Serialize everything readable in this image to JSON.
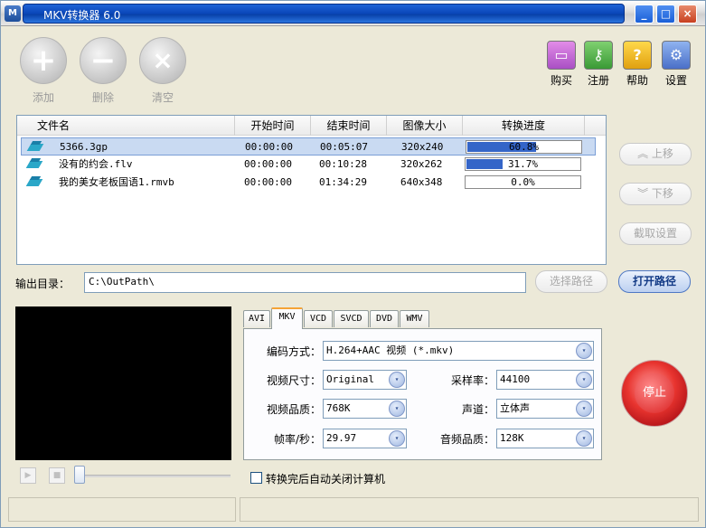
{
  "window": {
    "title": "MKV转换器 6.0"
  },
  "title_buttons": {
    "minimize": "_",
    "maximize": "□",
    "close": "×"
  },
  "toolbar": {
    "add": "添加",
    "delete": "删除",
    "clear": "清空"
  },
  "tools": {
    "buy": "购买",
    "register": "注册",
    "help": "帮助",
    "settings": "设置"
  },
  "columns": [
    "文件名",
    "开始时间",
    "结束时间",
    "图像大小",
    "转换进度"
  ],
  "files": [
    {
      "name": "5366.3gp",
      "start": "00:00:00",
      "end": "00:05:07",
      "size": "320x240",
      "progress_text": "60.8%",
      "progress": 0.608,
      "selected": true
    },
    {
      "name": "没有的约会.flv",
      "start": "00:00:00",
      "end": "00:10:28",
      "size": "320x262",
      "progress_text": "31.7%",
      "progress": 0.317,
      "selected": false
    },
    {
      "name": "我的美女老板国语1.rmvb",
      "start": "00:00:00",
      "end": "01:34:29",
      "size": "640x348",
      "progress_text": "0.0%",
      "progress": 0.0,
      "selected": false
    }
  ],
  "side_buttons": {
    "move_up": "上移",
    "move_down": "下移",
    "crop_settings": "截取设置"
  },
  "output": {
    "label": "输出目录：",
    "path": "C:\\OutPath\\",
    "choose": "选择路径",
    "open": "打开路径"
  },
  "tabs": [
    "AVI",
    "MKV",
    "VCD",
    "SVCD",
    "DVD",
    "WMV"
  ],
  "active_tab": "MKV",
  "settings": {
    "codec_label": "编码方式：",
    "codec_value": "H.264+AAC 视频 (*.mkv)",
    "video_size_label": "视频尺寸：",
    "video_size_value": "Original",
    "sample_rate_label": "采样率：",
    "sample_rate_value": "44100",
    "video_quality_label": "视频品质：",
    "video_quality_value": "768K",
    "channel_label": "声道：",
    "channel_value": "立体声",
    "fps_label": "帧率/秒：",
    "fps_value": "29.97",
    "audio_quality_label": "音频品质：",
    "audio_quality_value": "128K"
  },
  "stop_button": "停止",
  "shutdown_checkbox": "转换完后自动关闭计算机"
}
